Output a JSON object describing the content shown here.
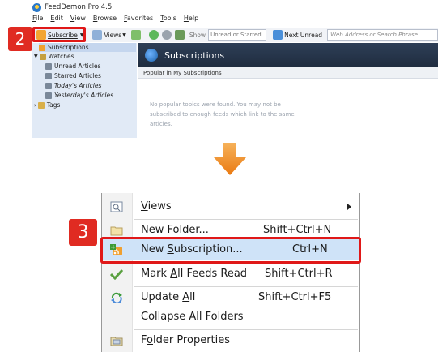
{
  "app": {
    "title": "FeedDemon Pro 4.5",
    "menu": [
      "File",
      "Edit",
      "View",
      "Browse",
      "Favorites",
      "Tools",
      "Help"
    ],
    "toolbar": {
      "subscribe": "Subscribe",
      "views": "Views",
      "show": "Show",
      "show_value": "Unread or Starred",
      "next_unread": "Next Unread",
      "address_placeholder": "Web Address or Search Phrase"
    },
    "sidebar": {
      "items": [
        {
          "label": "Subscriptions"
        },
        {
          "label": "Watches"
        },
        {
          "label": "Unread Articles"
        },
        {
          "label": "Starred Articles"
        },
        {
          "label": "Today's Articles"
        },
        {
          "label": "Yesterday's Articles"
        },
        {
          "label": "Tags"
        }
      ]
    },
    "main": {
      "header": "Subscriptions",
      "subheader": "Popular in My Subscriptions",
      "message": "No popular topics were found. You may not be subscribed to enough feeds which link to the same articles."
    }
  },
  "badges": {
    "step2": "2",
    "step3": "3"
  },
  "menu": {
    "items": [
      {
        "label": "Views",
        "shortcut": ""
      },
      {
        "label": "New Folder...",
        "shortcut": "Shift+Ctrl+N"
      },
      {
        "label": "New Subscription...",
        "shortcut": "Ctrl+N"
      },
      {
        "label": "Mark All Feeds Read",
        "shortcut": "Shift+Ctrl+R"
      },
      {
        "label": "Update All",
        "shortcut": "Shift+Ctrl+F5"
      },
      {
        "label": "Collapse All Folders",
        "shortcut": ""
      },
      {
        "label": "Folder Properties",
        "shortcut": ""
      }
    ]
  },
  "colors": {
    "highlight_red": "#e01818",
    "badge_red": "#e02b22",
    "arrow_orange": "#f08a1e",
    "menu_highlight": "#cfe3f8",
    "sidebar_bg": "#e1eaf6"
  }
}
